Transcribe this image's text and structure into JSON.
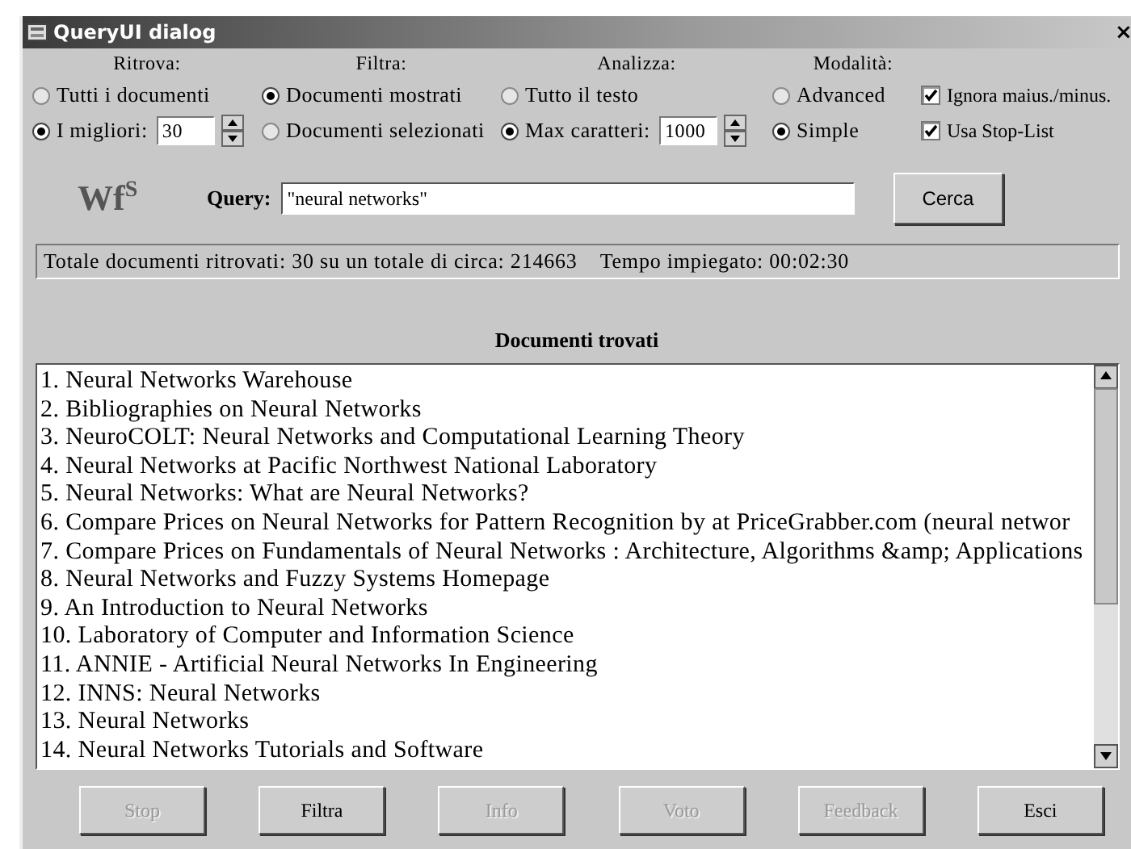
{
  "window": {
    "title": "QueryUI dialog",
    "close": "×"
  },
  "groups": [
    {
      "heading": "Ritrova:",
      "rows": [
        [
          {
            "kind": "radio",
            "label": "Tutti i documenti",
            "selected": false
          }
        ],
        [
          {
            "kind": "radio",
            "label": "I migliori:",
            "selected": true,
            "spin": "30"
          }
        ]
      ]
    },
    {
      "heading": "Filtra:",
      "rows": [
        [
          {
            "kind": "radio",
            "label": "Documenti mostrati",
            "selected": true
          }
        ],
        [
          {
            "kind": "radio",
            "label": "Documenti selezionati",
            "selected": false
          }
        ]
      ]
    },
    {
      "heading": "Analizza:",
      "rows": [
        [
          {
            "kind": "radio",
            "label": "Tutto il testo",
            "selected": false
          }
        ],
        [
          {
            "kind": "radio",
            "label": "Max caratteri:",
            "selected": true,
            "spin": "1000"
          }
        ]
      ]
    },
    {
      "heading": "Modalità:",
      "rows": [
        [
          {
            "kind": "radio",
            "label": "Advanced",
            "selected": false
          },
          {
            "kind": "checkbox",
            "label": "Ignora maius./minus.",
            "checked": true
          }
        ],
        [
          {
            "kind": "radio",
            "label": "Simple",
            "selected": true
          },
          {
            "kind": "checkbox",
            "label": "Usa Stop-List",
            "checked": true
          }
        ]
      ]
    }
  ],
  "logo": "Wf$^{S}$",
  "query": {
    "label": "Query:",
    "value": "\"neural networks\""
  },
  "search_button": "Cerca",
  "status_bar": [
    "Totale documenti ritrovati: 30 su un totale di circa: 214663",
    "Tempo impiegato: 00:02:30"
  ],
  "results": {
    "heading": "Documenti trovati",
    "items": [
      "1. Neural Networks Warehouse",
      "2. Bibliographies on Neural Networks",
      "3. NeuroCOLT: Neural Networks and Computational Learning Theory",
      "4. Neural Networks at Pacific Northwest National Laboratory",
      "5. Neural Networks: What are Neural Networks?",
      "6. Compare Prices on Neural Networks for Pattern Recognition by at PriceGrabber.com (neural networ",
      "7. Compare Prices on Fundamentals of Neural Networks : Architecture, Algorithms &amp; Applications",
      "8. Neural Networks and Fuzzy Systems Homepage",
      "9. An Introduction to Neural Networks",
      "10. Laboratory of Computer and Information Science",
      "11. ANNIE - Artificial Neural Networks In Engineering",
      "12. INNS: Neural Networks",
      "13. Neural Networks",
      "14. Neural Networks Tutorials and Software"
    ]
  },
  "buttons": [
    {
      "label": "Stop",
      "disabled": true
    },
    {
      "label": "Filtra",
      "disabled": false
    },
    {
      "label": "Info",
      "disabled": true
    },
    {
      "label": "Voto",
      "disabled": true
    },
    {
      "label": "Feedback",
      "disabled": true
    },
    {
      "label": "Esci",
      "disabled": false
    }
  ]
}
